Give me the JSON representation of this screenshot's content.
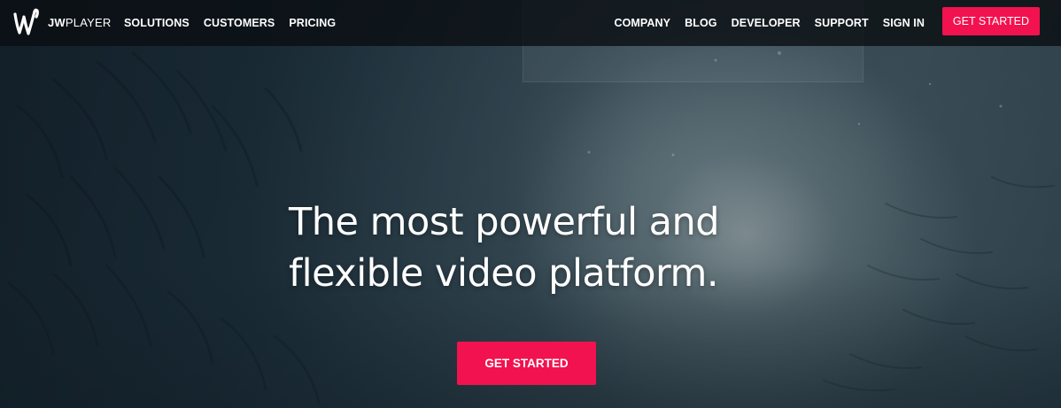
{
  "brand": {
    "name_bold": "JW",
    "name_light": "PLAYER",
    "logo_icon": "jwplayer-w-icon"
  },
  "nav": {
    "left_items": [
      {
        "label": "SOLUTIONS"
      },
      {
        "label": "CUSTOMERS"
      },
      {
        "label": "PRICING"
      }
    ],
    "right_items": [
      {
        "label": "COMPANY"
      },
      {
        "label": "BLOG"
      },
      {
        "label": "DEVELOPER"
      },
      {
        "label": "SUPPORT"
      },
      {
        "label": "SIGN IN"
      }
    ],
    "cta_label": "GET STARTED"
  },
  "hero": {
    "headline_line1": "The most powerful and",
    "headline_line2": "flexible video platform.",
    "cta_label": "GET STARTED",
    "background": "underwater-light-image"
  },
  "colors": {
    "accent": "#f2124f",
    "nav_background": "#0a0e12",
    "text": "#ffffff"
  }
}
